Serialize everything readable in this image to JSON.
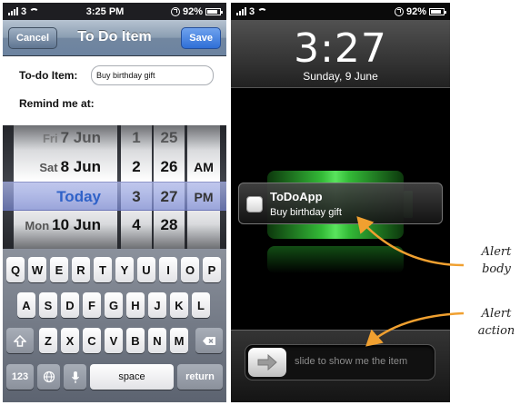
{
  "left_phone": {
    "status": {
      "carrier": "3",
      "time": "3:25 PM",
      "battery": "92%"
    },
    "nav": {
      "cancel_label": "Cancel",
      "title": "To Do Item",
      "save_label": "Save"
    },
    "form": {
      "todo_label": "To-do Item:",
      "todo_value": "Buy birthday gift",
      "remind_label": "Remind me at:"
    },
    "picker": {
      "dates": [
        {
          "dow": "Fri",
          "day": "7 Jun"
        },
        {
          "dow": "Sat",
          "day": "8 Jun"
        },
        {
          "dow": "",
          "day": "Today"
        },
        {
          "dow": "Mon",
          "day": "10 Jun"
        }
      ],
      "hours": [
        "1",
        "2",
        "3",
        "4"
      ],
      "minutes": [
        "25",
        "26",
        "27",
        "28"
      ],
      "ampm": [
        "AM",
        "PM"
      ]
    },
    "keyboard": {
      "row1": [
        "Q",
        "W",
        "E",
        "R",
        "T",
        "Y",
        "U",
        "I",
        "O",
        "P"
      ],
      "row2": [
        "A",
        "S",
        "D",
        "F",
        "G",
        "H",
        "J",
        "K",
        "L"
      ],
      "row3": [
        "Z",
        "X",
        "C",
        "V",
        "B",
        "N",
        "M"
      ],
      "numbers_key": "123",
      "space_key": "space",
      "return_key": "return"
    }
  },
  "right_phone": {
    "status": {
      "carrier": "3",
      "battery": "92%"
    },
    "clock": "3:27",
    "date": "Sunday, 9 June",
    "alert": {
      "app_name": "ToDoApp",
      "body": "Buy birthday gift"
    },
    "slider_text": "slide to show me the item"
  },
  "annotations": {
    "alert_body_line1": "Alert",
    "alert_body_line2": "body",
    "alert_action_line1": "Alert",
    "alert_action_line2": "action"
  },
  "colors": {
    "nav_blue": "#6c83a0",
    "save_blue": "#2f6fd6",
    "picker_selection": "#8d95c8",
    "battery_green": "#36c43a",
    "arrow_orange": "#f0a030"
  }
}
